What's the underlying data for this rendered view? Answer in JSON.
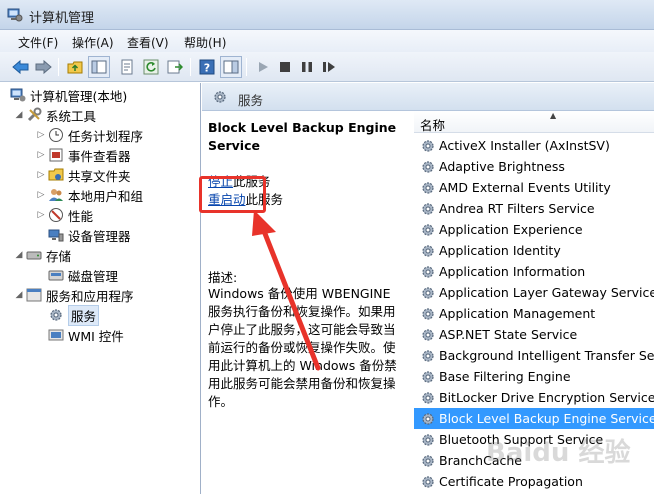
{
  "window": {
    "title": "计算机管理"
  },
  "menu": [
    "文件(F)",
    "操作(A)",
    "查看(V)",
    "帮助(H)"
  ],
  "tree": {
    "root": "计算机管理(本地)",
    "system_tools": "系统工具",
    "task_scheduler": "任务计划程序",
    "event_viewer": "事件查看器",
    "shared_folders": "共享文件夹",
    "local_users": "本地用户和组",
    "performance": "性能",
    "device_manager": "设备管理器",
    "storage": "存储",
    "disk_management": "磁盘管理",
    "services_apps": "服务和应用程序",
    "services": "服务",
    "wmi": "WMI 控件"
  },
  "center": {
    "header": "服务",
    "service_title": "Block Level Backup Engine Service",
    "stop_link": "停止",
    "stop_suffix": "此服务",
    "restart_link": "重启动",
    "restart_suffix": "此服务",
    "desc_label": "描述:",
    "desc_text": "Windows 备份使用 WBENGINE 服务执行备份和恢复操作。如果用户停止了此服务，这可能会导致当前运行的备份或恢复操作失败。使用此计算机上的 Windows 备份禁用此服务可能会禁用备份和恢复操作。"
  },
  "list": {
    "column_name": "名称",
    "services": [
      "ActiveX Installer (AxInstSV)",
      "Adaptive Brightness",
      "AMD External Events Utility",
      "Andrea RT Filters Service",
      "Application Experience",
      "Application Identity",
      "Application Information",
      "Application Layer Gateway Service",
      "Application Management",
      "ASP.NET State Service",
      "Background Intelligent Transfer Servi",
      "Base Filtering Engine",
      "BitLocker Drive Encryption Service",
      "Block Level Backup Engine Service",
      "Bluetooth Support Service",
      "BranchCache",
      "Certificate Propagation"
    ],
    "selected_index": 13
  },
  "watermark": "Baidu 经验",
  "colors": {
    "selection": "#3399ff",
    "link": "#0645ad",
    "annotation": "#e8332a"
  }
}
